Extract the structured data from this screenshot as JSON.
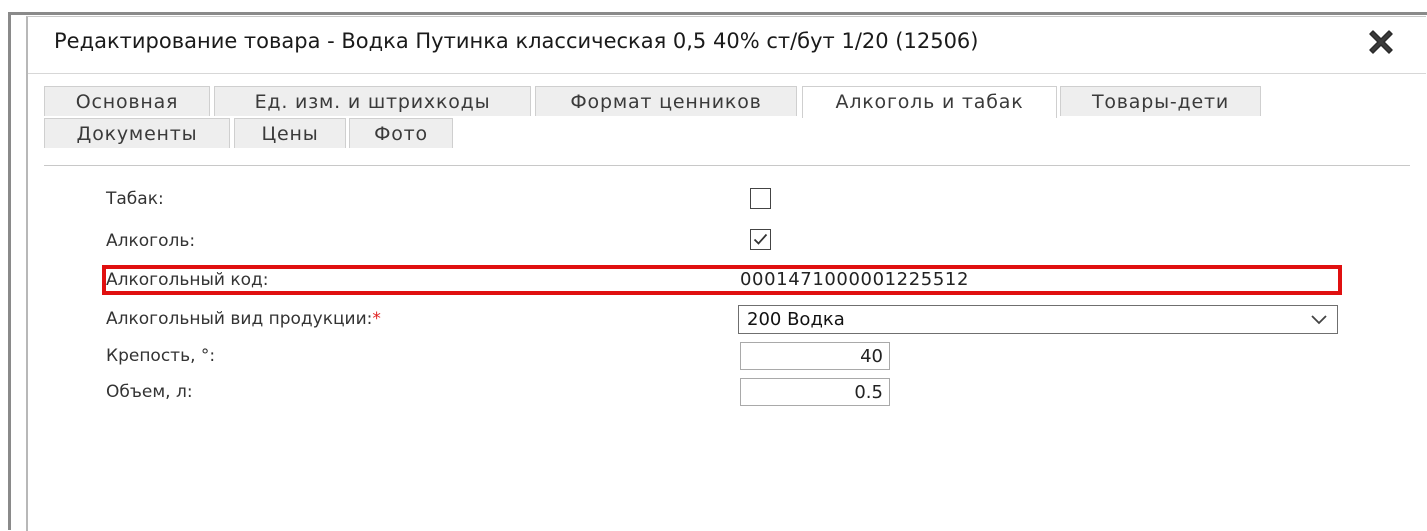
{
  "dialog": {
    "title": "Редактирование товара - Водка Путинка классическая 0,5 40% ст/бут 1/20 (12506)",
    "close_icon": "close-x-icon"
  },
  "tabs": {
    "row1": [
      {
        "label": "Основная",
        "active": false
      },
      {
        "label": "Ед. изм. и штрихкоды",
        "active": false
      },
      {
        "label": "Формат ценников",
        "active": false
      },
      {
        "label": "Алкоголь и табак",
        "active": true
      },
      {
        "label": "Товары-дети",
        "active": false
      }
    ],
    "row2": [
      {
        "label": "Документы",
        "active": false
      },
      {
        "label": "Цены",
        "active": false
      },
      {
        "label": "Фото",
        "active": false
      }
    ]
  },
  "form": {
    "tobacco": {
      "label": "Табак:",
      "checked": false
    },
    "alcohol": {
      "label": "Алкоголь:",
      "checked": true
    },
    "alcohol_code": {
      "label": "Алкогольный код:",
      "value": "0001471000001225512"
    },
    "product_type": {
      "label": "Алкогольный вид продукции:",
      "required_mark": "*",
      "value": "200 Водка"
    },
    "strength": {
      "label": "Крепость, °:",
      "value": "40"
    },
    "volume": {
      "label": "Объем, л:",
      "value": "0.5"
    }
  },
  "colors": {
    "highlight": "#e01010",
    "required": "#e02020"
  }
}
